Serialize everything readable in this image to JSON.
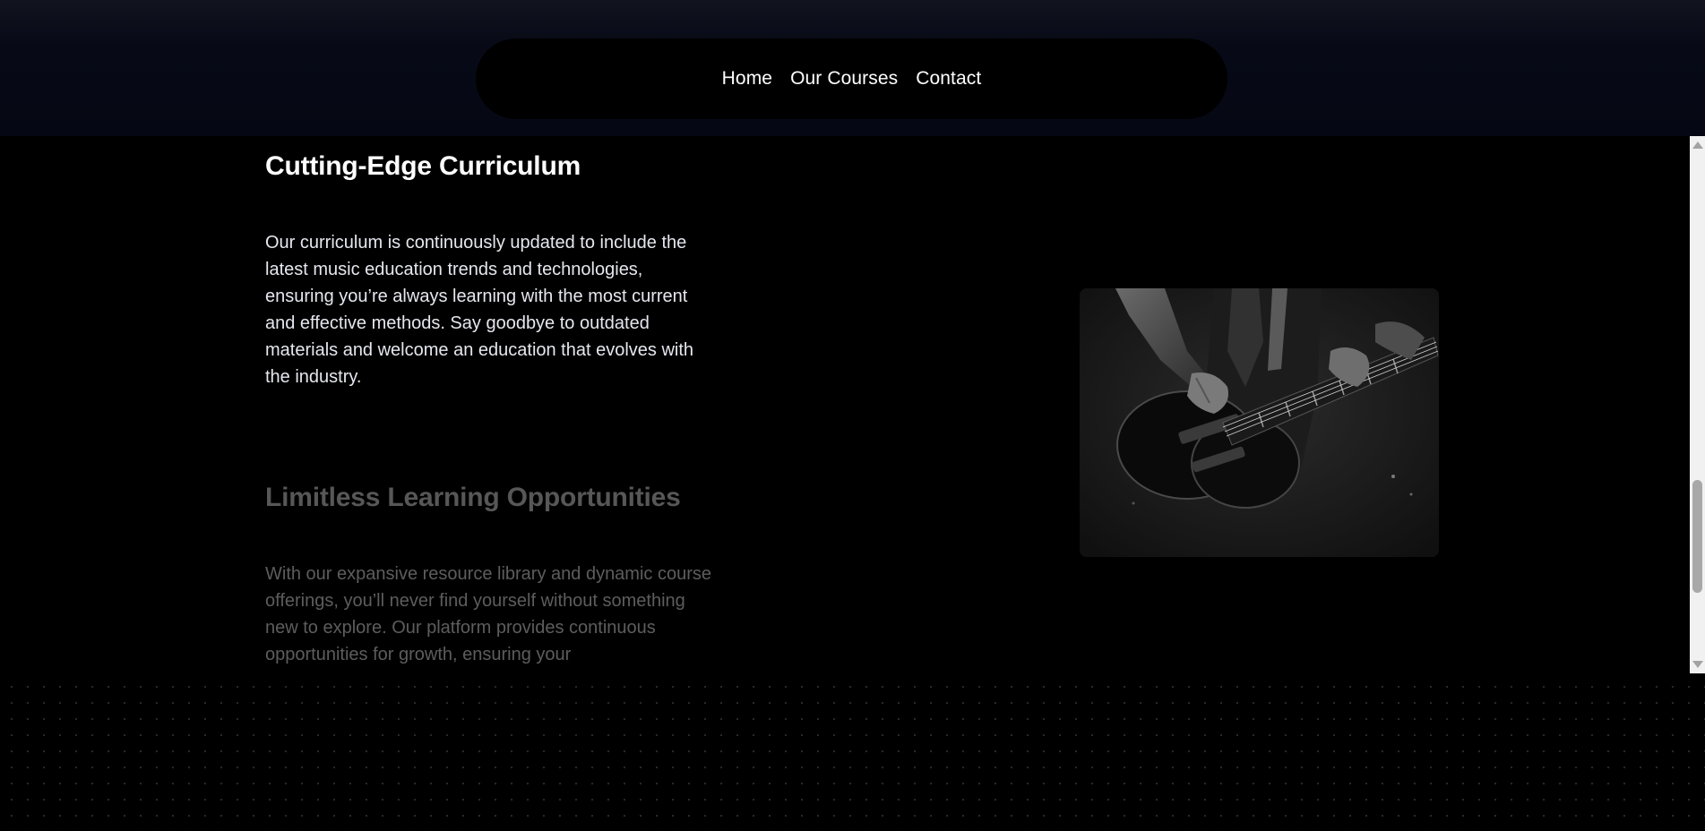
{
  "nav": {
    "items": [
      {
        "label": "Home"
      },
      {
        "label": "Our Courses"
      },
      {
        "label": "Contact"
      }
    ]
  },
  "features": [
    {
      "title": "Cutting-Edge Curriculum",
      "body": "Our curriculum is continuously updated to include the latest music education trends and technologies, ensuring you’re always learning with the most current and effective methods. Say goodbye to outdated materials and welcome an education that evolves with the industry."
    },
    {
      "title": "Limitless Learning Opportunities",
      "body": "With our expansive resource library and dynamic course offerings, you’ll never find yourself without something new to explore. Our platform provides continuous opportunities for growth, ensuring your"
    }
  ],
  "image": {
    "subject": "guitar-player-photo"
  },
  "colors": {
    "background": "#000000",
    "header_band": "#050814",
    "nav_pill": "#000000",
    "text_active": "#ffffff",
    "text_dim": "#575757"
  }
}
